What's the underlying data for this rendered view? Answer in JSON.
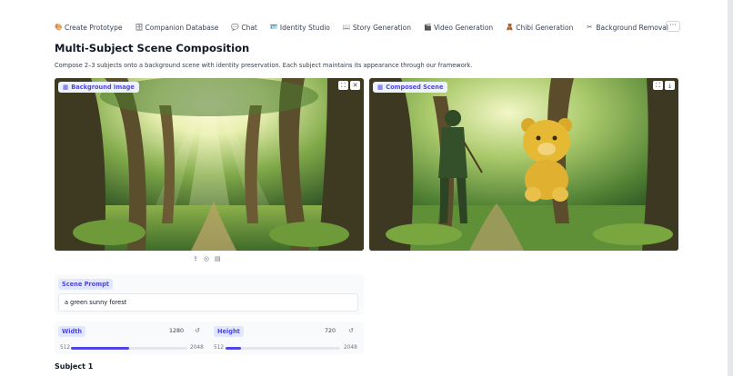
{
  "tabs": [
    {
      "label": "Create Prototype",
      "icon": "palette-icon",
      "glyph": "🎨"
    },
    {
      "label": "Companion Database",
      "icon": "database-icon",
      "glyph": "🗄"
    },
    {
      "label": "Chat",
      "icon": "chat-icon",
      "glyph": "💬"
    },
    {
      "label": "Identity Studio",
      "icon": "id-icon",
      "glyph": "🪪"
    },
    {
      "label": "Story Generation",
      "icon": "book-icon",
      "glyph": "📖"
    },
    {
      "label": "Video Generation",
      "icon": "clapper-icon",
      "glyph": "🎬"
    },
    {
      "label": "Chibi Generation",
      "icon": "figure-icon",
      "glyph": "🧸"
    },
    {
      "label": "Background Removal",
      "icon": "scissors-icon",
      "glyph": "✂"
    }
  ],
  "more_label": "···",
  "page": {
    "title": "Multi-Subject Scene Composition",
    "description": "Compose 2–3 subjects onto a background scene with identity preservation. Each subject maintains its appearance through our framework."
  },
  "background_panel": {
    "label": "Background Image"
  },
  "composed_panel": {
    "label": "Composed Scene"
  },
  "prompt": {
    "label": "Scene Prompt",
    "value": "a green sunny forest"
  },
  "width": {
    "label": "Width",
    "value": 1280,
    "min": 512,
    "max": 2048
  },
  "height": {
    "label": "Height",
    "value": 720,
    "min": 512,
    "max": 2048
  },
  "subject_heading": "Subject 1",
  "colors": {
    "accent": "#4f46e5",
    "badge_bg": "#eef2ff"
  }
}
